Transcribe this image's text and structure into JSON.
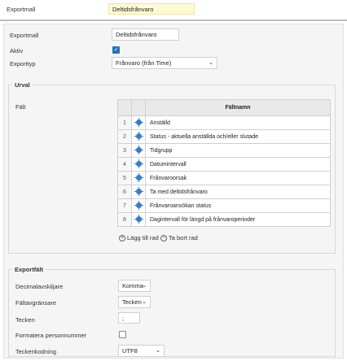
{
  "top": {
    "label": "Exportmall",
    "value": "Deltidsfrånvaro"
  },
  "form": {
    "exportmall_label": "Exportmall",
    "exportmall_value": "Deltidsfrånvaro",
    "aktiv_label": "Aktiv",
    "aktiv_checked": true,
    "exporttyp_label": "Exporttyp",
    "exporttyp_value": "Frånvaro (från Time)"
  },
  "urval": {
    "legend": "Urval",
    "falt_label": "Fält",
    "table_header": "Fältnamn",
    "rows": [
      {
        "num": "1",
        "name": "Anställd"
      },
      {
        "num": "2",
        "name": "Status - aktuella anställda och/eller slutade"
      },
      {
        "num": "3",
        "name": "Tidgrupp"
      },
      {
        "num": "4",
        "name": "Datumintervall"
      },
      {
        "num": "5",
        "name": "Frånvaroorsak"
      },
      {
        "num": "6",
        "name": "Ta med deltidsfrånvaro"
      },
      {
        "num": "7",
        "name": "Frånvaroansökan status"
      },
      {
        "num": "8",
        "name": "Dagintervall för längd på frånvaroperioder"
      }
    ],
    "add_row": "Lägg till rad",
    "remove_row": "Ta bort rad"
  },
  "exportfalt": {
    "legend": "Exportfält",
    "decimal_label": "Decimalavskiljare",
    "decimal_value": "Komma",
    "faltavgransare_label": "Fältavgränsare",
    "faltavgransare_value": "Tecken",
    "tecken_label": "Tecken",
    "tecken_value": ";",
    "formatera_label": "Formatera personnummer",
    "formatera_checked": false,
    "teckenkodning_label": "Teckenkodning",
    "teckenkodning_value": "UTF8"
  },
  "icons": {
    "drag": "drag-move-icon",
    "add": "plus-circle-icon",
    "remove": "minus-circle-icon",
    "chevron": "chevron-down-icon"
  },
  "colors": {
    "accent": "#2a6ebb",
    "highlight": "#fefbd3"
  }
}
